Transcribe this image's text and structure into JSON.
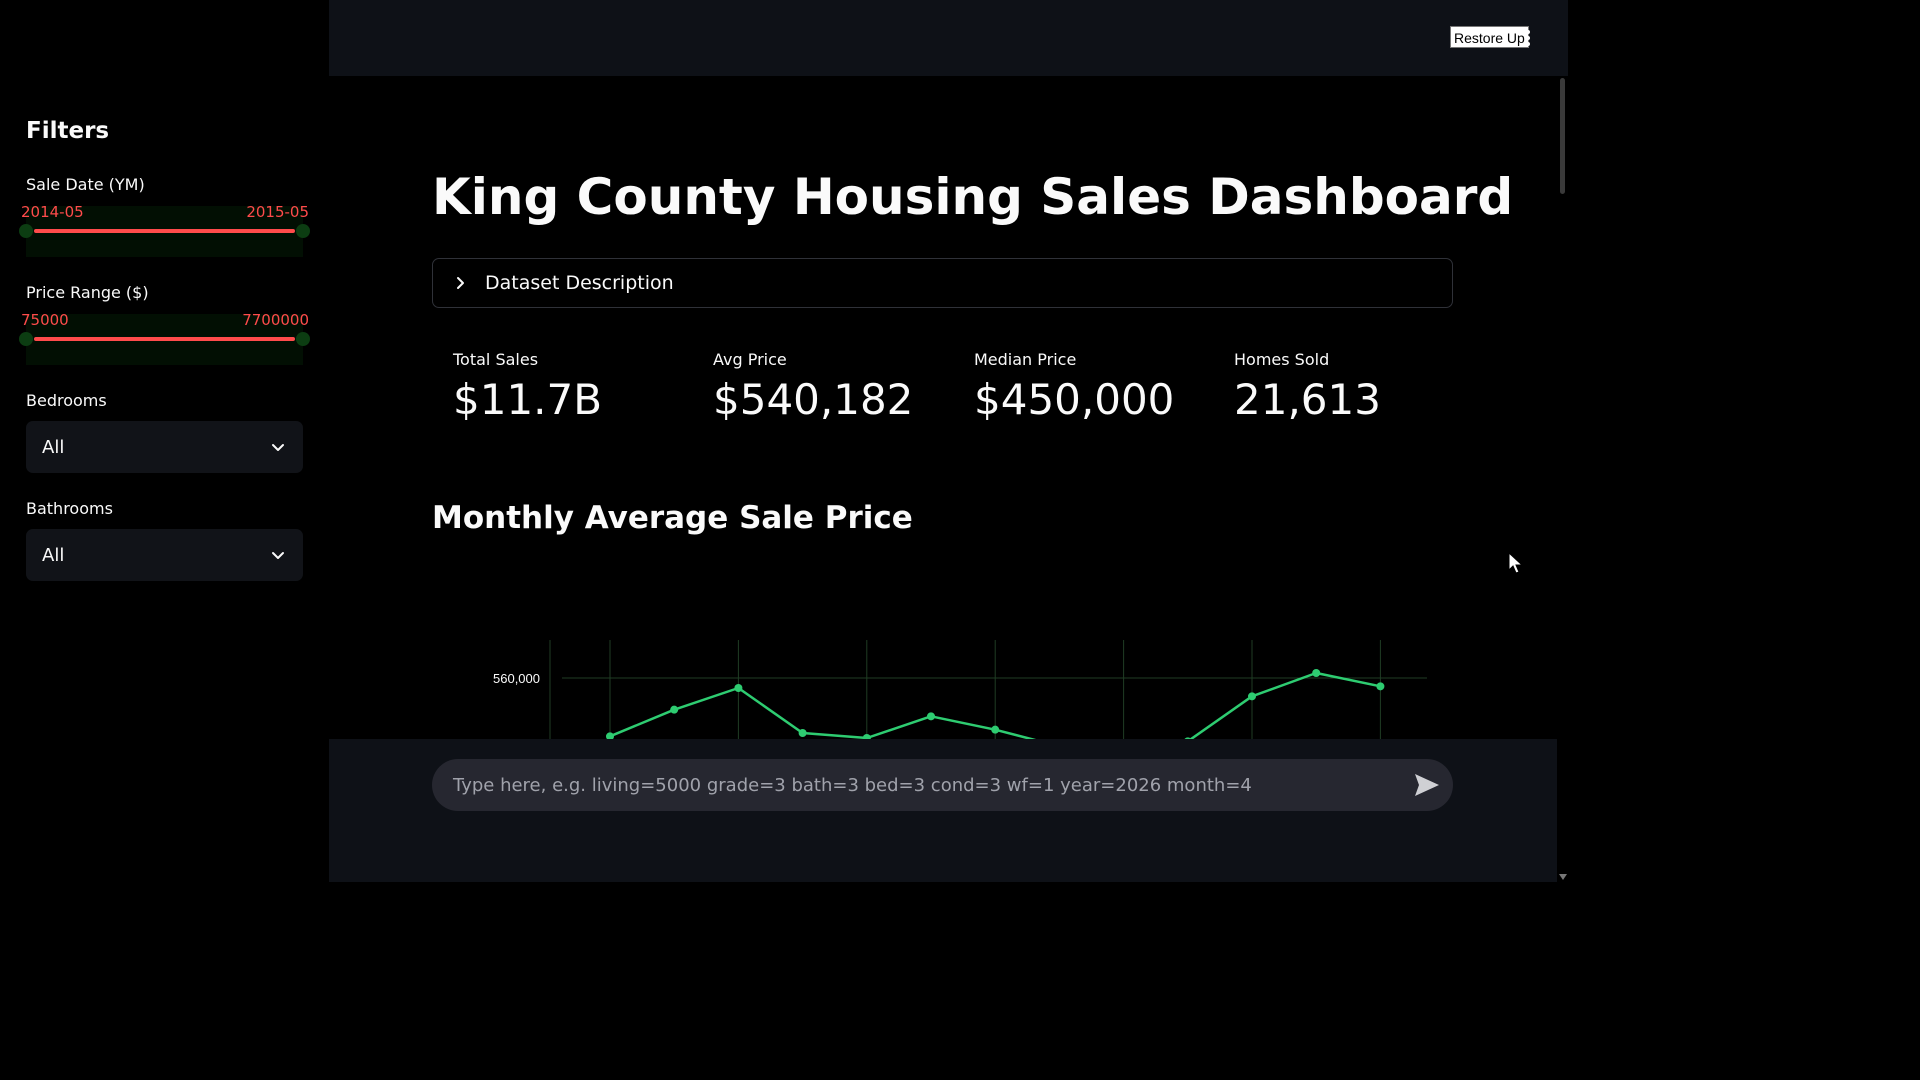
{
  "sidebar": {
    "title": "Filters",
    "sale_date": {
      "label": "Sale Date (YM)",
      "min": "2014-05",
      "max": "2015-05"
    },
    "price_range": {
      "label": "Price Range ($)",
      "min": "75000",
      "max": "7700000"
    },
    "bedrooms": {
      "label": "Bedrooms",
      "value": "All"
    },
    "bathrooms": {
      "label": "Bathrooms",
      "value": "All"
    }
  },
  "topbar": {
    "restore_button": "Restore Up"
  },
  "main": {
    "title": "King County Housing Sales Dashboard",
    "expander": {
      "label": "Dataset Description"
    },
    "metrics": [
      {
        "label": "Total Sales",
        "value": "$11.7B"
      },
      {
        "label": "Avg Price",
        "value": "$540,182"
      },
      {
        "label": "Median Price",
        "value": "$450,000"
      },
      {
        "label": "Homes Sold",
        "value": "21,613"
      }
    ],
    "chart_section_title": "Monthly Average Sale Price"
  },
  "chat": {
    "placeholder": "Type here, e.g. living=5000 grade=3 bath=3 bed=3 cond=3 wf=1 year=2026 month=4"
  },
  "colors": {
    "accent": "#ff4b4b",
    "line": "#2ecc71",
    "sidebar_bg": "#000000",
    "topbar_bg": "#0e1117"
  },
  "chart_data": {
    "type": "line",
    "title": "",
    "xlabel": "",
    "ylabel": "",
    "y_tick_labels": [
      "560,000"
    ],
    "x": [
      1,
      2,
      3,
      4,
      5,
      6,
      7,
      8,
      9,
      10,
      11,
      12,
      13
    ],
    "series": [
      {
        "values": [
          525000,
          541000,
          554000,
          527000,
          524000,
          537000,
          529000,
          519000,
          518000,
          522000,
          549000,
          563000,
          555000
        ]
      }
    ],
    "grid": true
  }
}
